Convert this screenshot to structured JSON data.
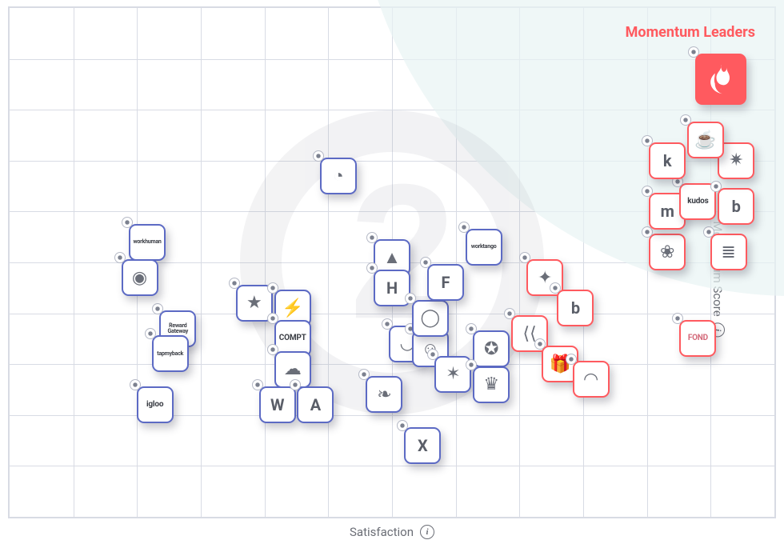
{
  "axes": {
    "x_label": "Satisfaction",
    "y_label": "Momentum Score"
  },
  "region_label": "Momentum Leaders",
  "chart_data": {
    "type": "scatter",
    "xlabel": "Satisfaction",
    "ylabel": "Momentum Score",
    "xlim": [
      0,
      100
    ],
    "ylim": [
      0,
      100
    ],
    "title": "Momentum Leaders",
    "regions": [
      {
        "name": "Momentum Leaders",
        "shape": "arc-upper-right"
      }
    ],
    "points": [
      {
        "name": "workhuman",
        "label": "workhuman",
        "x": 18,
        "y": 54,
        "leader": false
      },
      {
        "name": "reward-gateway",
        "label": "Reward Gateway",
        "x": 22,
        "y": 37,
        "leader": false
      },
      {
        "name": "tapmyback",
        "label": "tapmyback",
        "x": 21,
        "y": 32,
        "leader": false
      },
      {
        "name": "igloo",
        "label": "igloo",
        "x": 19,
        "y": 22,
        "leader": false
      },
      {
        "name": "globe-vendor",
        "label": "",
        "x": 17,
        "y": 47,
        "leader": false
      },
      {
        "name": "vendor-a-blank",
        "label": "",
        "x": 43,
        "y": 67,
        "leader": false
      },
      {
        "name": "star-badge",
        "label": "",
        "x": 32,
        "y": 42,
        "leader": false
      },
      {
        "name": "bolt-vendor",
        "label": "",
        "x": 37,
        "y": 41,
        "leader": false
      },
      {
        "name": "compt",
        "label": "COMPT",
        "x": 37,
        "y": 35,
        "leader": false
      },
      {
        "name": "vendor-cloud",
        "label": "",
        "x": 37,
        "y": 29,
        "leader": false
      },
      {
        "name": "wv-vendor",
        "label": "W",
        "x": 35,
        "y": 22,
        "leader": false
      },
      {
        "name": "capital-a",
        "label": "A",
        "x": 40,
        "y": 22,
        "leader": false
      },
      {
        "name": "astro-vendor",
        "label": "",
        "x": 50,
        "y": 51,
        "leader": false
      },
      {
        "name": "hh-vendor",
        "label": "H",
        "x": 50,
        "y": 45,
        "leader": false
      },
      {
        "name": "smile-vendor",
        "label": "",
        "x": 52,
        "y": 34,
        "leader": false
      },
      {
        "name": "face-vendor",
        "label": "",
        "x": 55,
        "y": 33,
        "leader": false
      },
      {
        "name": "circle-o",
        "label": "",
        "x": 55,
        "y": 39,
        "leader": false
      },
      {
        "name": "carrot-vendor",
        "label": "",
        "x": 49,
        "y": 24,
        "leader": false
      },
      {
        "name": "x-box",
        "label": "X",
        "x": 54,
        "y": 14,
        "leader": false
      },
      {
        "name": "ff-flag",
        "label": "F",
        "x": 57,
        "y": 46,
        "leader": false
      },
      {
        "name": "worktango",
        "label": "worktango",
        "x": 62,
        "y": 53,
        "leader": false
      },
      {
        "name": "starburst",
        "label": "",
        "x": 58,
        "y": 28,
        "leader": false
      },
      {
        "name": "star-ring",
        "label": "",
        "x": 63,
        "y": 33,
        "leader": false
      },
      {
        "name": "crown-vendor",
        "label": "",
        "x": 63,
        "y": 26,
        "leader": false
      },
      {
        "name": "compass",
        "label": "",
        "x": 70,
        "y": 47,
        "leader": true
      },
      {
        "name": "kk-vendor",
        "label": "",
        "x": 68,
        "y": 36,
        "leader": true
      },
      {
        "name": "b-box",
        "label": "b",
        "x": 74,
        "y": 41,
        "leader": true
      },
      {
        "name": "gift-vendor",
        "label": "",
        "x": 72,
        "y": 30,
        "leader": true
      },
      {
        "name": "chat-vendor",
        "label": "",
        "x": 76,
        "y": 27,
        "leader": true
      },
      {
        "name": "fond",
        "label": "FOND",
        "x": 90,
        "y": 35,
        "leader": true
      },
      {
        "name": "leaf-vendor",
        "label": "",
        "x": 86,
        "y": 52,
        "leader": true
      },
      {
        "name": "books-vendor",
        "label": "",
        "x": 94,
        "y": 52,
        "leader": true
      },
      {
        "name": "mo-vendor",
        "label": "m",
        "x": 86,
        "y": 60,
        "leader": true
      },
      {
        "name": "kudos",
        "label": "kudos",
        "x": 90,
        "y": 62,
        "leader": true
      },
      {
        "name": "b-swirl",
        "label": "b",
        "x": 95,
        "y": 61,
        "leader": true
      },
      {
        "name": "k-circle",
        "label": "k",
        "x": 86,
        "y": 70,
        "leader": true
      },
      {
        "name": "spark-vendor",
        "label": "",
        "x": 95,
        "y": 70,
        "leader": true
      },
      {
        "name": "coffee-vendor",
        "label": "",
        "x": 91,
        "y": 74,
        "leader": true
      },
      {
        "name": "hero-vendor",
        "label": "",
        "x": 93,
        "y": 86,
        "leader": true,
        "hero": true
      }
    ]
  },
  "icons": {
    "globe-vendor": "◉",
    "star-badge": "★",
    "bolt-vendor": "⚡",
    "vendor-cloud": "☁",
    "astro-vendor": "▲",
    "smile-vendor": "◡",
    "face-vendor": "☺",
    "circle-o": "◯",
    "carrot-vendor": "❧",
    "starburst": "✶",
    "star-ring": "✪",
    "crown-vendor": "♛",
    "compass": "✦",
    "kk-vendor": "⟨⟨",
    "gift-vendor": "🎁",
    "chat-vendor": "◠",
    "leaf-vendor": "❀",
    "books-vendor": "≣",
    "spark-vendor": "✷",
    "coffee-vendor": "☕",
    "hero-vendor": "❂",
    "vendor-a-blank": "◔",
    "hh-vendor": "H",
    "ff-flag": "F"
  }
}
